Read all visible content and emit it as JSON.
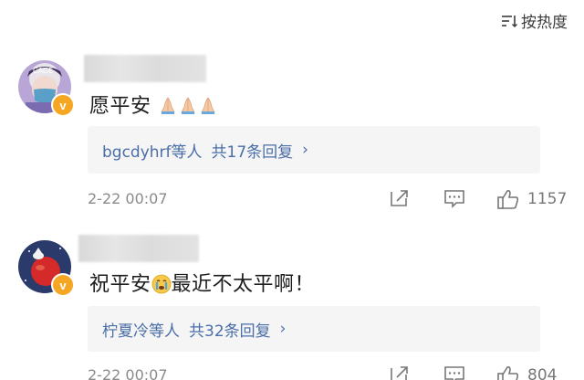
{
  "sort": {
    "label": "按热度",
    "icon": "sort-lines-icon"
  },
  "comments": [
    {
      "avatar_icon": "avatar-masked-person",
      "verified": "v",
      "text": "愿平安",
      "emojis": [
        "folded-hands",
        "folded-hands",
        "folded-hands"
      ],
      "replies": {
        "who": "bgcdyhrf等人",
        "count": "共17条回复",
        "chevron": "›"
      },
      "time": "2-22 00:07",
      "likes": "1157"
    },
    {
      "avatar_icon": "avatar-red-planet",
      "verified": "v",
      "text_before": "祝平安",
      "emoji": "crying-face",
      "text_after": "最近不太平啊！",
      "replies": {
        "who": "柠夏冷等人",
        "count": "共32条回复",
        "chevron": "›"
      },
      "time": "2-22 00:07",
      "likes": "804"
    }
  ]
}
